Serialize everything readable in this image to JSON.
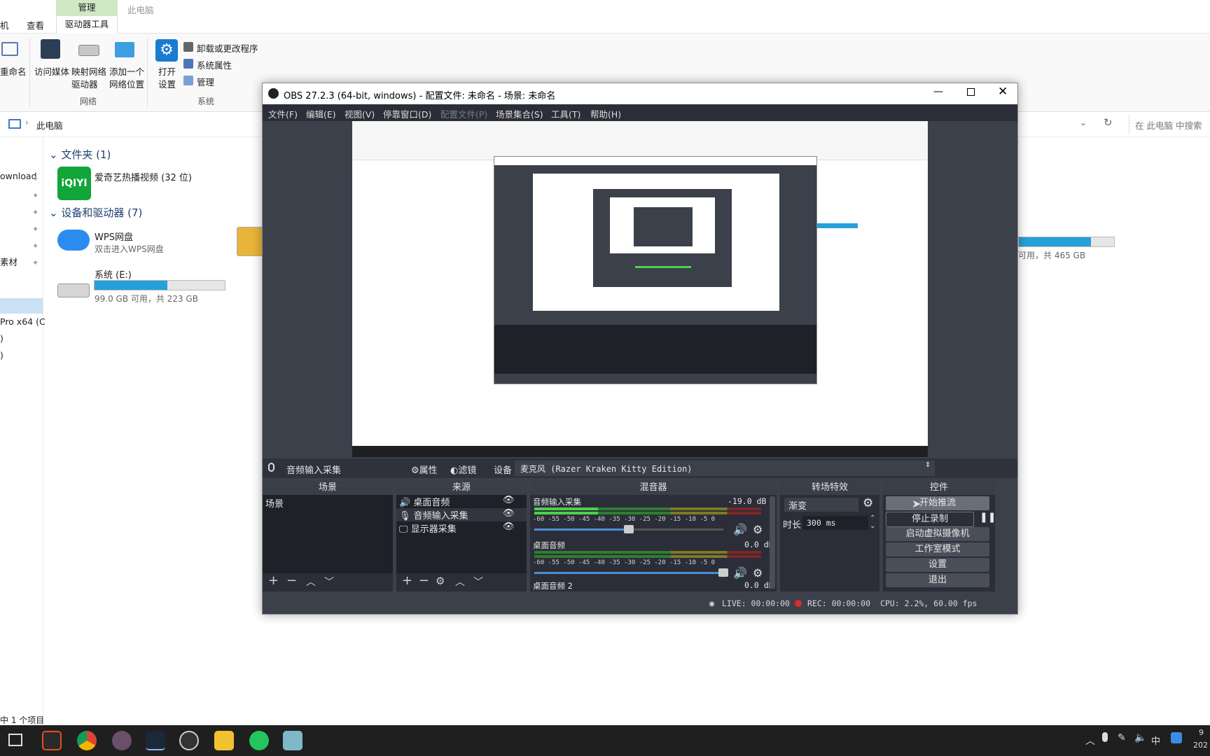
{
  "explorer": {
    "tabs": {
      "manage": "管理",
      "view": "查看",
      "drive_tools": "驱动器工具",
      "this_pc_title": "此电脑",
      "partial_tab": "机"
    },
    "ribbon": {
      "rename": "重命名",
      "access_media": "访问媒体",
      "map_drive_1": "映射网络",
      "map_drive_2": "驱动器",
      "add_location_1": "添加一个",
      "add_location_2": "网络位置",
      "network_group": "网络",
      "open_settings_1": "打开",
      "open_settings_2": "设置",
      "uninstall": "卸载或更改程序",
      "system_props": "系统属性",
      "manage": "管理",
      "system_group": "系统"
    },
    "address": {
      "path": "此电脑",
      "search_placeholder": "在 此电脑 中搜索"
    },
    "nav": [
      "ownload",
      "素材",
      "Pro x64 (C",
      ")",
      ")"
    ],
    "folders_header": "文件夹 (1)",
    "folder_item": "爱奇艺热播视频 (32 位)",
    "iqiyi_logo": "iQIYI",
    "devices_header": "设备和驱动器 (7)",
    "wps_name": "WPS网盘",
    "wps_desc": "双击进入WPS网盘",
    "drive_e_name": "系统 (E:)",
    "drive_e_free": "99.0 GB 可用，共 223 GB",
    "drive_e_fill": 0.56,
    "drive_right_free": "可用，共 465 GB",
    "drive_right_fill": 0.76,
    "status": "中 1 个项目"
  },
  "obs": {
    "title": "OBS 27.2.3 (64-bit, windows) - 配置文件: 未命名 - 场景: 未命名",
    "menu": [
      "文件(F)",
      "编辑(E)",
      "视图(V)",
      "停靠窗口(D)",
      "配置文件(P)",
      "场景集合(S)",
      "工具(T)",
      "帮助(H)"
    ],
    "dockbar": {
      "source": "音频输入采集",
      "properties": "属性",
      "filters": "滤镜",
      "device_label": "设备",
      "device_value": "麦克风 (Razer Kraken Kitty Edition)"
    },
    "scenes": {
      "header": "场景",
      "items": [
        "场景"
      ]
    },
    "sources": {
      "header": "来源",
      "items": [
        "桌面音频",
        "音频输入采集",
        "显示器采集"
      ]
    },
    "mixer": {
      "header": "混音器",
      "channels": [
        {
          "name": "音频输入采集",
          "db": "-19.0 dB",
          "volume": 0.5
        },
        {
          "name": "桌面音频",
          "db": "0.0 dB",
          "volume": 1.0
        },
        {
          "name": "桌面音频 2",
          "db": "0.0 dB"
        }
      ],
      "scale": [
        "-60",
        "-55",
        "-50",
        "-45",
        "-40",
        "-35",
        "-30",
        "-25",
        "-20",
        "-15",
        "-10",
        "-5",
        "0"
      ]
    },
    "transitions": {
      "header": "转场特效",
      "selected": "渐变",
      "duration_label": "时长",
      "duration_value": "300 ms"
    },
    "controls": {
      "header": "控件",
      "start_stream": "开始推流",
      "stop_record": "停止录制",
      "virtual_cam": "启动虚拟摄像机",
      "studio_mode": "工作室模式",
      "settings": "设置",
      "exit": "退出"
    },
    "status": {
      "live": "LIVE: 00:00:00",
      "rec": "REC: 00:00:00",
      "cpu": "CPU: 2.2%, 60.00 fps"
    }
  },
  "taskbar": {
    "ime": "中",
    "clock_partial_1": "9",
    "clock_partial_2": "202"
  },
  "colors": {
    "obs_bg": "#3c404b",
    "obs_panel": "#2b2e38",
    "accent_blue": "#26a0da",
    "ribbon_tab": "#cfe8c4"
  }
}
